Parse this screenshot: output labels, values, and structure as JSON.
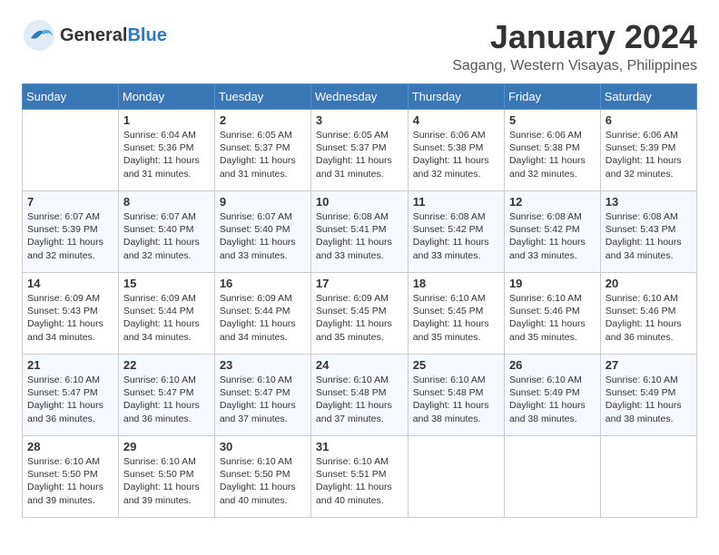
{
  "header": {
    "logo_general": "General",
    "logo_blue": "Blue",
    "month_title": "January 2024",
    "location": "Sagang, Western Visayas, Philippines"
  },
  "days_of_week": [
    "Sunday",
    "Monday",
    "Tuesday",
    "Wednesday",
    "Thursday",
    "Friday",
    "Saturday"
  ],
  "weeks": [
    [
      {
        "day": "",
        "info": ""
      },
      {
        "day": "1",
        "info": "Sunrise: 6:04 AM\nSunset: 5:36 PM\nDaylight: 11 hours\nand 31 minutes."
      },
      {
        "day": "2",
        "info": "Sunrise: 6:05 AM\nSunset: 5:37 PM\nDaylight: 11 hours\nand 31 minutes."
      },
      {
        "day": "3",
        "info": "Sunrise: 6:05 AM\nSunset: 5:37 PM\nDaylight: 11 hours\nand 31 minutes."
      },
      {
        "day": "4",
        "info": "Sunrise: 6:06 AM\nSunset: 5:38 PM\nDaylight: 11 hours\nand 32 minutes."
      },
      {
        "day": "5",
        "info": "Sunrise: 6:06 AM\nSunset: 5:38 PM\nDaylight: 11 hours\nand 32 minutes."
      },
      {
        "day": "6",
        "info": "Sunrise: 6:06 AM\nSunset: 5:39 PM\nDaylight: 11 hours\nand 32 minutes."
      }
    ],
    [
      {
        "day": "7",
        "info": "Sunrise: 6:07 AM\nSunset: 5:39 PM\nDaylight: 11 hours\nand 32 minutes."
      },
      {
        "day": "8",
        "info": "Sunrise: 6:07 AM\nSunset: 5:40 PM\nDaylight: 11 hours\nand 32 minutes."
      },
      {
        "day": "9",
        "info": "Sunrise: 6:07 AM\nSunset: 5:40 PM\nDaylight: 11 hours\nand 33 minutes."
      },
      {
        "day": "10",
        "info": "Sunrise: 6:08 AM\nSunset: 5:41 PM\nDaylight: 11 hours\nand 33 minutes."
      },
      {
        "day": "11",
        "info": "Sunrise: 6:08 AM\nSunset: 5:42 PM\nDaylight: 11 hours\nand 33 minutes."
      },
      {
        "day": "12",
        "info": "Sunrise: 6:08 AM\nSunset: 5:42 PM\nDaylight: 11 hours\nand 33 minutes."
      },
      {
        "day": "13",
        "info": "Sunrise: 6:08 AM\nSunset: 5:43 PM\nDaylight: 11 hours\nand 34 minutes."
      }
    ],
    [
      {
        "day": "14",
        "info": "Sunrise: 6:09 AM\nSunset: 5:43 PM\nDaylight: 11 hours\nand 34 minutes."
      },
      {
        "day": "15",
        "info": "Sunrise: 6:09 AM\nSunset: 5:44 PM\nDaylight: 11 hours\nand 34 minutes."
      },
      {
        "day": "16",
        "info": "Sunrise: 6:09 AM\nSunset: 5:44 PM\nDaylight: 11 hours\nand 34 minutes."
      },
      {
        "day": "17",
        "info": "Sunrise: 6:09 AM\nSunset: 5:45 PM\nDaylight: 11 hours\nand 35 minutes."
      },
      {
        "day": "18",
        "info": "Sunrise: 6:10 AM\nSunset: 5:45 PM\nDaylight: 11 hours\nand 35 minutes."
      },
      {
        "day": "19",
        "info": "Sunrise: 6:10 AM\nSunset: 5:46 PM\nDaylight: 11 hours\nand 35 minutes."
      },
      {
        "day": "20",
        "info": "Sunrise: 6:10 AM\nSunset: 5:46 PM\nDaylight: 11 hours\nand 36 minutes."
      }
    ],
    [
      {
        "day": "21",
        "info": "Sunrise: 6:10 AM\nSunset: 5:47 PM\nDaylight: 11 hours\nand 36 minutes."
      },
      {
        "day": "22",
        "info": "Sunrise: 6:10 AM\nSunset: 5:47 PM\nDaylight: 11 hours\nand 36 minutes."
      },
      {
        "day": "23",
        "info": "Sunrise: 6:10 AM\nSunset: 5:47 PM\nDaylight: 11 hours\nand 37 minutes."
      },
      {
        "day": "24",
        "info": "Sunrise: 6:10 AM\nSunset: 5:48 PM\nDaylight: 11 hours\nand 37 minutes."
      },
      {
        "day": "25",
        "info": "Sunrise: 6:10 AM\nSunset: 5:48 PM\nDaylight: 11 hours\nand 38 minutes."
      },
      {
        "day": "26",
        "info": "Sunrise: 6:10 AM\nSunset: 5:49 PM\nDaylight: 11 hours\nand 38 minutes."
      },
      {
        "day": "27",
        "info": "Sunrise: 6:10 AM\nSunset: 5:49 PM\nDaylight: 11 hours\nand 38 minutes."
      }
    ],
    [
      {
        "day": "28",
        "info": "Sunrise: 6:10 AM\nSunset: 5:50 PM\nDaylight: 11 hours\nand 39 minutes."
      },
      {
        "day": "29",
        "info": "Sunrise: 6:10 AM\nSunset: 5:50 PM\nDaylight: 11 hours\nand 39 minutes."
      },
      {
        "day": "30",
        "info": "Sunrise: 6:10 AM\nSunset: 5:50 PM\nDaylight: 11 hours\nand 40 minutes."
      },
      {
        "day": "31",
        "info": "Sunrise: 6:10 AM\nSunset: 5:51 PM\nDaylight: 11 hours\nand 40 minutes."
      },
      {
        "day": "",
        "info": ""
      },
      {
        "day": "",
        "info": ""
      },
      {
        "day": "",
        "info": ""
      }
    ]
  ]
}
